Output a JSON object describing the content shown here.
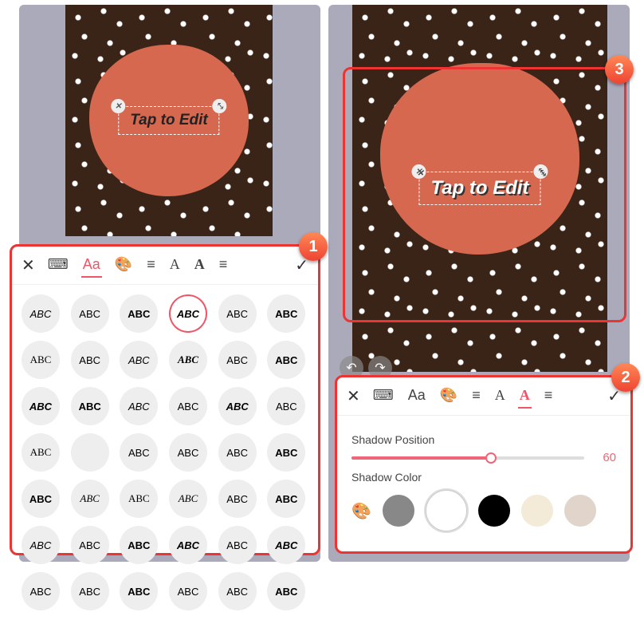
{
  "canvas_text": "Tap to Edit",
  "badges": {
    "p1": "1",
    "p2": "2",
    "p3": "3"
  },
  "tabs": {
    "close": "✕",
    "keyboard": "⌨",
    "font": "Aa",
    "color": "🎨",
    "align": "≡",
    "style": "A",
    "outline": "A",
    "shadow": "A",
    "settings": "≡",
    "check": "✓"
  },
  "font_grid": [
    {
      "t": "ABC",
      "s": "italic",
      "w": "normal"
    },
    {
      "t": "ABC",
      "s": "normal",
      "w": "normal"
    },
    {
      "t": "ABC",
      "s": "normal",
      "w": "900"
    },
    {
      "t": "ABC",
      "s": "italic",
      "w": "bold",
      "sel": true
    },
    {
      "t": "ABC",
      "s": "normal",
      "w": "normal"
    },
    {
      "t": "ABC",
      "s": "normal",
      "w": "bold"
    },
    {
      "t": "ABC",
      "s": "normal",
      "w": "normal",
      "f": "cursive"
    },
    {
      "t": "ABC",
      "s": "normal",
      "w": "normal"
    },
    {
      "t": "ABC",
      "s": "italic",
      "w": "normal"
    },
    {
      "t": "ABC",
      "s": "italic",
      "w": "bold",
      "f": "cursive"
    },
    {
      "t": "ABC",
      "s": "normal",
      "w": "normal"
    },
    {
      "t": "ABC",
      "s": "normal",
      "w": "bold"
    },
    {
      "t": "ABC",
      "s": "italic",
      "w": "bold"
    },
    {
      "t": "ABC",
      "s": "normal",
      "w": "bold"
    },
    {
      "t": "ABC",
      "s": "italic",
      "w": "normal"
    },
    {
      "t": "ABC",
      "s": "normal",
      "w": "normal"
    },
    {
      "t": "ABC",
      "s": "italic",
      "w": "bold"
    },
    {
      "t": "ABC",
      "s": "normal",
      "w": "normal"
    },
    {
      "t": "ABC",
      "s": "normal",
      "w": "normal",
      "f": "cursive"
    },
    {
      "t": "",
      "s": "normal",
      "w": "normal"
    },
    {
      "t": "ABC",
      "s": "normal",
      "w": "normal"
    },
    {
      "t": "ABC",
      "s": "normal",
      "w": "normal"
    },
    {
      "t": "ABC",
      "s": "normal",
      "w": "normal"
    },
    {
      "t": "ABC",
      "s": "normal",
      "w": "bold"
    },
    {
      "t": "ABC",
      "s": "normal",
      "w": "bold"
    },
    {
      "t": "ABC",
      "s": "italic",
      "w": "normal",
      "f": "cursive"
    },
    {
      "t": "ABC",
      "s": "normal",
      "w": "normal",
      "f": "serif"
    },
    {
      "t": "ABC",
      "s": "italic",
      "w": "normal",
      "f": "cursive"
    },
    {
      "t": "ABC",
      "s": "normal",
      "w": "normal"
    },
    {
      "t": "ABC",
      "s": "normal",
      "w": "900"
    },
    {
      "t": "ABC",
      "s": "italic",
      "w": "normal"
    },
    {
      "t": "ABC",
      "s": "normal",
      "w": "normal"
    },
    {
      "t": "ABC",
      "s": "normal",
      "w": "bold"
    },
    {
      "t": "ABC",
      "s": "italic",
      "w": "bold"
    },
    {
      "t": "ABC",
      "s": "normal",
      "w": "normal"
    },
    {
      "t": "ABC",
      "s": "italic",
      "w": "900"
    },
    {
      "t": "ABC",
      "s": "normal",
      "w": "normal"
    },
    {
      "t": "ABC",
      "s": "normal",
      "w": "normal"
    },
    {
      "t": "ABC",
      "s": "normal",
      "w": "bold"
    },
    {
      "t": "ABC",
      "s": "normal",
      "w": "normal"
    },
    {
      "t": "ABC",
      "s": "normal",
      "w": "normal"
    },
    {
      "t": "ABC",
      "s": "normal",
      "w": "bold"
    }
  ],
  "shadow": {
    "position_label": "Shadow Position",
    "position_value": "60",
    "position_pct": 60,
    "color_label": "Shadow Color",
    "colors": [
      {
        "hex": "#888",
        "sel": false
      },
      {
        "hex": "#fff",
        "sel": true
      },
      {
        "hex": "#000",
        "sel": false
      },
      {
        "hex": "#f3ead8",
        "sel": false
      },
      {
        "hex": "#e0d4cb",
        "sel": false
      }
    ]
  }
}
